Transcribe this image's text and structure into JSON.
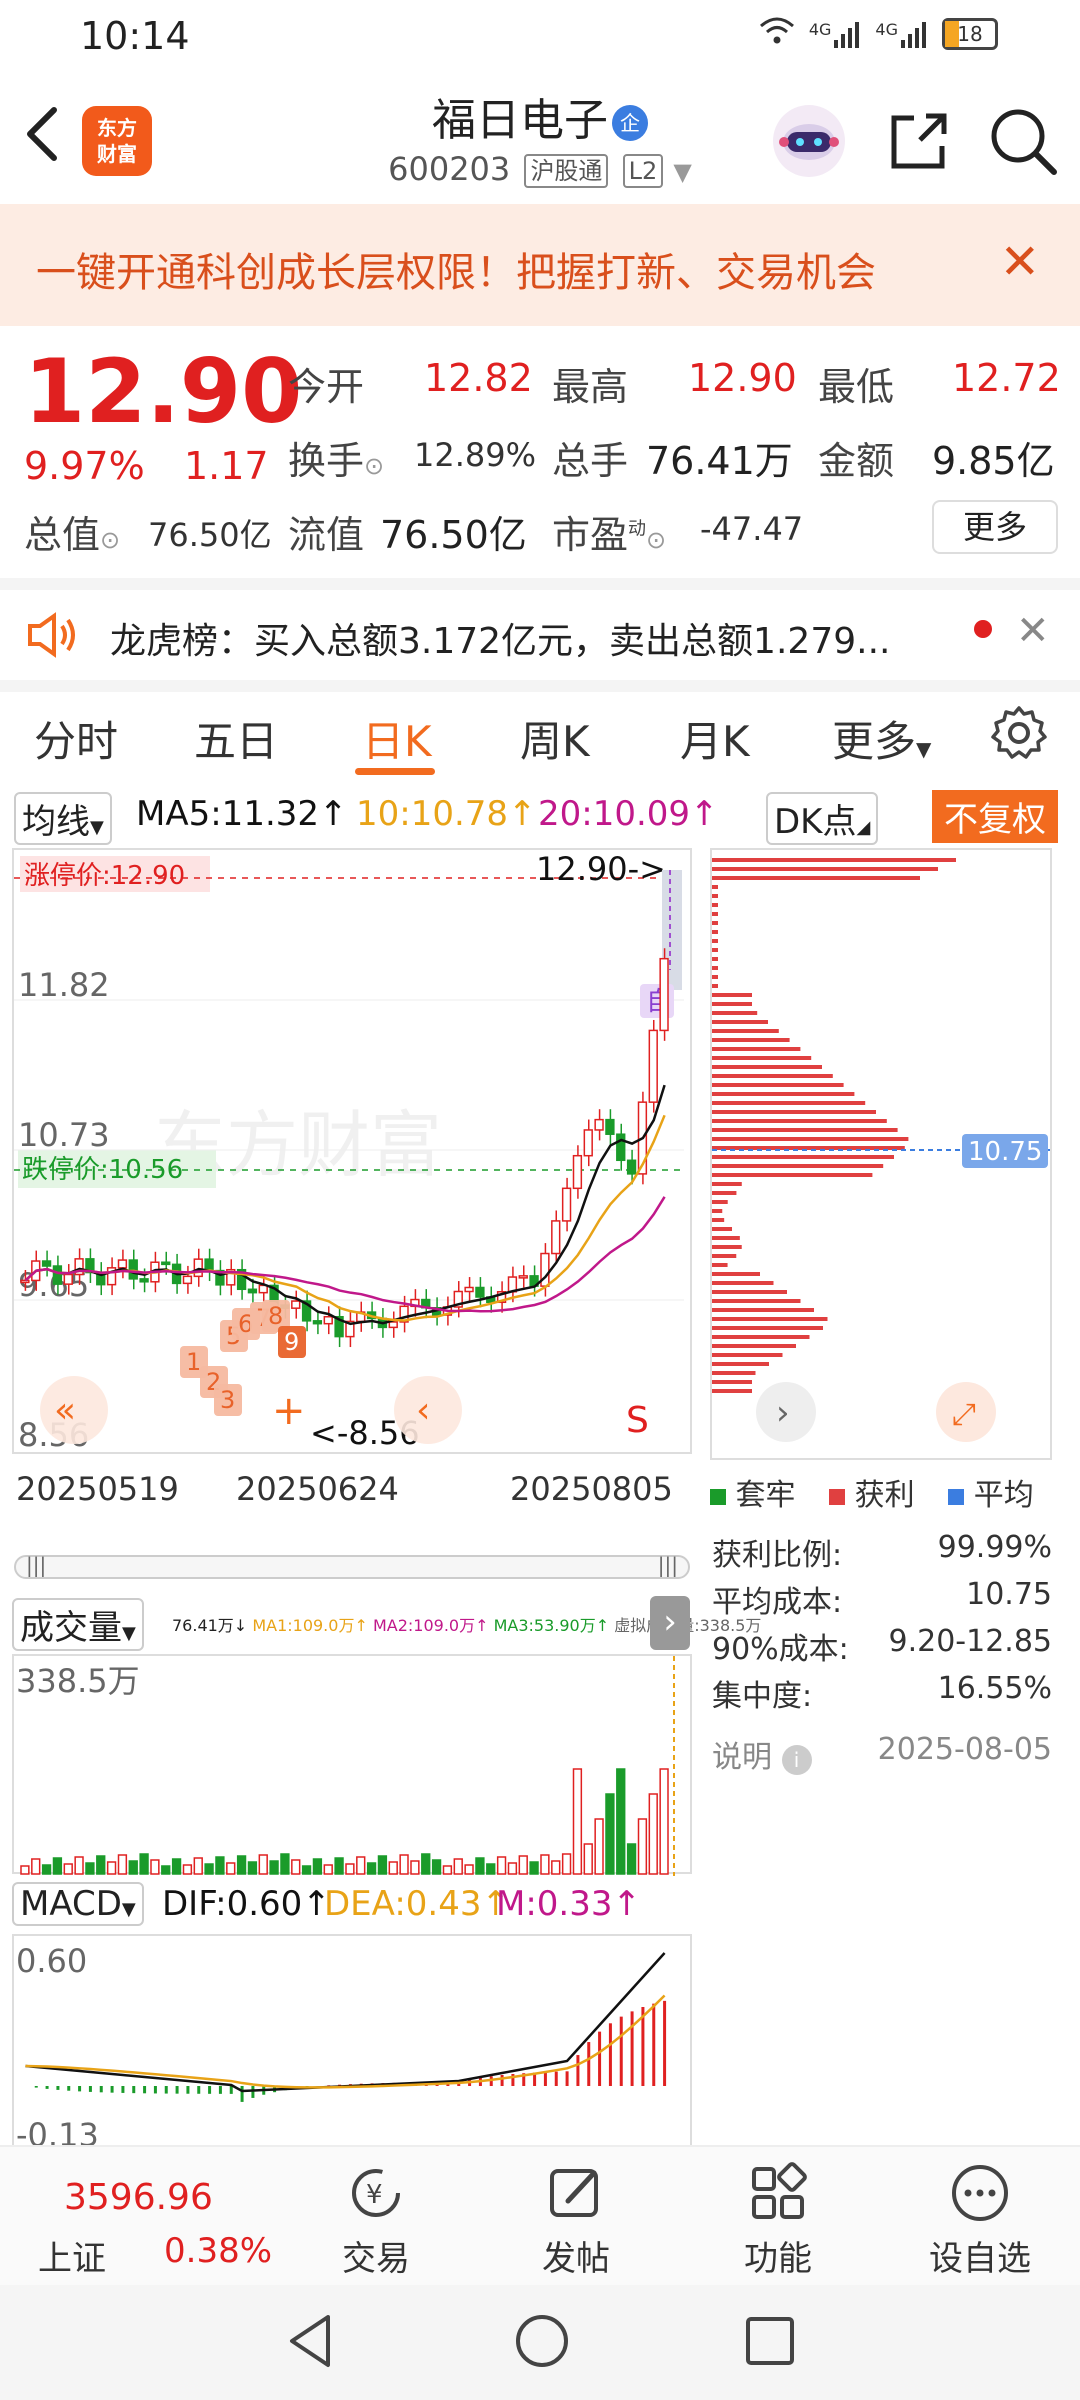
{
  "status_bar": {
    "time": "10:14",
    "network": "4G",
    "network2": "4G",
    "battery": "18"
  },
  "header": {
    "app_logo_line1": "东方",
    "app_logo_line2": "财富",
    "stock_name": "福日电子",
    "badge": "企",
    "stock_code": "600203",
    "tag_hgt": "沪股通",
    "tag_l2": "L2"
  },
  "banner": {
    "text": "一键开通科创成长层权限！把握打新、交易机会"
  },
  "quote": {
    "price": "12.90",
    "change_pct": "9.97%",
    "change_amt": "1.17",
    "open_label": "今开",
    "open": "12.82",
    "high_label": "最高",
    "high": "12.90",
    "low_label": "最低",
    "low": "12.72",
    "turnover_label": "换手",
    "turnover": "12.89%",
    "volume_label": "总手",
    "volume": "76.41万",
    "amount_label": "金额",
    "amount": "9.85亿",
    "mktcap_label": "总值",
    "mktcap": "76.50亿",
    "float_label": "流值",
    "float": "76.50亿",
    "pe_label": "市盈",
    "pe_sup": "动",
    "pe": "-47.47",
    "more": "更多"
  },
  "notice": {
    "text": "龙虎榜：买入总额3.172亿元，卖出总额1.279..."
  },
  "tabs": [
    "分时",
    "五日",
    "日K",
    "周K",
    "月K",
    "更多"
  ],
  "active_tab": 2,
  "ma_legend": {
    "selector": "均线",
    "ma5": "MA5:11.32↑",
    "ma10": "10:10.78↑",
    "ma20": "20:10.09↑",
    "dk": "DK点",
    "adjust": "不复权"
  },
  "kline": {
    "limit_up_label": "涨停价:12.90",
    "limit_down_label": "跌停价:10.56",
    "price_max_label": "12.90->",
    "price_min_label": "<-8.56",
    "y_labels": [
      "11.82",
      "10.73",
      "9.65",
      "8.56"
    ],
    "dates": [
      "20250519",
      "20250624",
      "20250805"
    ],
    "marker_self": "自",
    "marker_s": "S",
    "markers": [
      "1",
      "2",
      "3",
      "5",
      "6",
      "7",
      "8",
      "9"
    ],
    "watermark": "东方财富"
  },
  "chip": {
    "avg_label": "10.75",
    "legend": [
      "套牢",
      "获利",
      "平均"
    ],
    "stats": [
      {
        "label": "获利比例:",
        "value": "99.99%"
      },
      {
        "label": "平均成本:",
        "value": "10.75"
      },
      {
        "label": "90%成本:",
        "value": "9.20-12.85"
      },
      {
        "label": "集中度:",
        "value": "16.55%"
      }
    ],
    "note_label": "说明",
    "date": "2025-08-05"
  },
  "volume": {
    "selector": "成交量",
    "legend": "76.41万↓",
    "ma1": "MA1:109.0万↑",
    "ma2": "MA2:109.0万↑",
    "ma3": "MA3:53.90万↑",
    "virtual": "虚拟成交量:338.5万",
    "max_label": "338.5万"
  },
  "macd": {
    "selector": "MACD",
    "dif": "DIF:0.60↑",
    "dea": "DEA:0.43↑",
    "m": "M:0.33↑",
    "top_label": "0.60",
    "bottom_label": "-0.13"
  },
  "bottom_nav": {
    "index_value": "3596.96",
    "index_name": "上证",
    "index_change": "0.38%",
    "items": [
      "交易",
      "发帖",
      "功能",
      "设自选"
    ]
  },
  "colors": {
    "accent": "#f26b1f",
    "up": "#e02020",
    "down": "#1a9b2a",
    "ma5": "#111111",
    "ma10": "#e8a317",
    "ma20": "#c0188a"
  }
}
